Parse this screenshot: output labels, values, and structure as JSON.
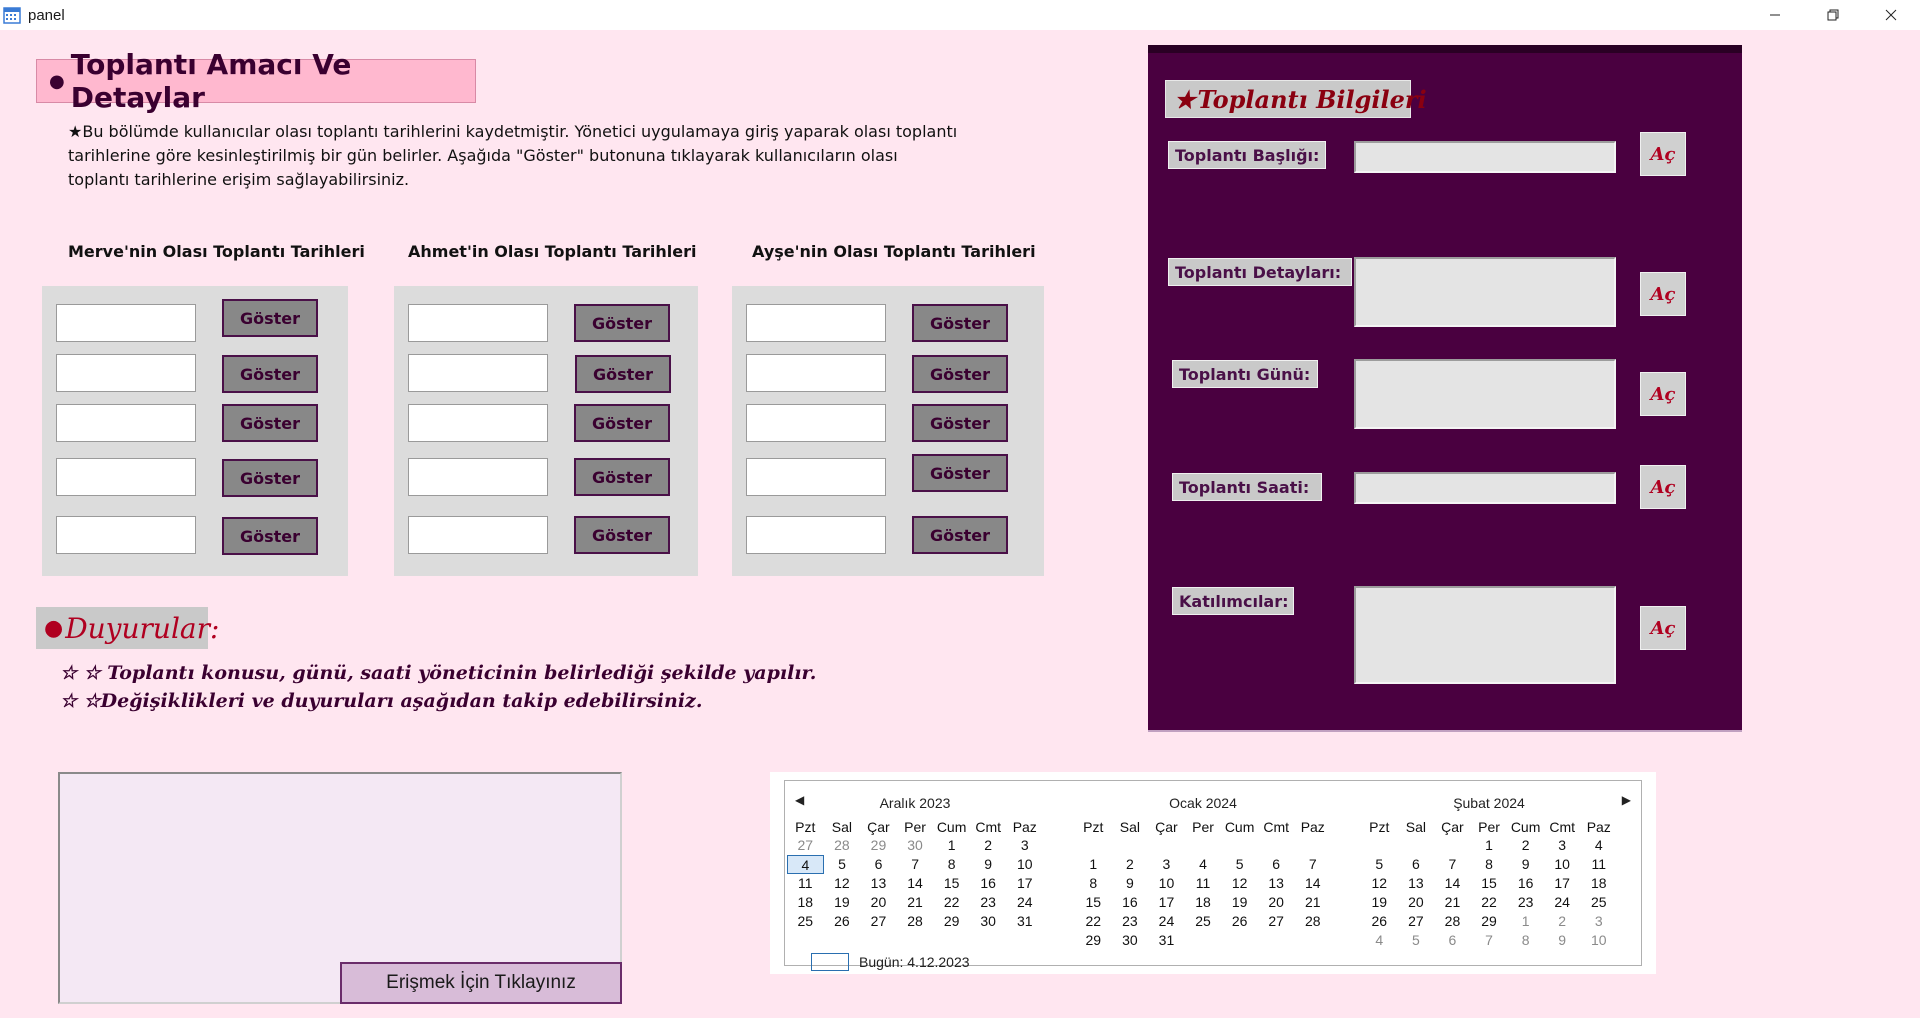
{
  "window": {
    "title": "panel",
    "icon": "calendar-app-icon"
  },
  "left": {
    "section_title": "Toplantı Amacı Ve Detaylar",
    "intro_lines": [
      "★Bu bölümde kullanıcılar olası toplantı tarihlerini kaydetmiştir. Yönetici uygulamaya giriş yaparak olası toplantı",
      "tarihlerine göre kesinleştirilmiş bir gün belirler. Aşağıda \"Göster\" butonuna tıklayarak kullanıcıların olası",
      "toplantı tarihlerine erişim sağlayabilirsiniz."
    ],
    "columns": [
      {
        "title": "Merve'nin Olası Toplantı Tarihleri",
        "button_label": "Göster",
        "values": [
          "",
          "",
          "",
          "",
          ""
        ]
      },
      {
        "title": "Ahmet'in Olası Toplantı Tarihleri",
        "button_label": "Göster",
        "values": [
          "",
          "",
          "",
          "",
          ""
        ]
      },
      {
        "title": "Ayşe'nin Olası Toplantı Tarihleri",
        "button_label": "Göster",
        "values": [
          "",
          "",
          "",
          "",
          ""
        ]
      }
    ]
  },
  "announcements": {
    "title": "Duyurular:",
    "lines": [
      "☆ ☆ Toplantı konusu, günü, saati yöneticinin belirlediği şekilde yapılır.",
      "☆ ☆Değişiklikleri ve duyuruları aşağıdan takip edebilirsiniz."
    ],
    "access_button": "Erişmek İçin Tıklayınız"
  },
  "info": {
    "title": "Toplantı Bilgileri",
    "open_label": "Aç",
    "fields": [
      {
        "label": "Toplantı Başlığı:",
        "value": ""
      },
      {
        "label": "Toplantı Detayları:",
        "value": ""
      },
      {
        "label": "Toplantı Günü:",
        "value": ""
      },
      {
        "label": "Toplantı Saati:",
        "value": ""
      },
      {
        "label": "Katılımcılar:",
        "value": ""
      }
    ]
  },
  "calendar": {
    "day_headers": [
      "Pzt",
      "Sal",
      "Çar",
      "Per",
      "Cum",
      "Cmt",
      "Paz"
    ],
    "today_label": "Bugün: 4.12.2023",
    "selected": "4",
    "months": [
      {
        "name": "Aralık 2023",
        "weeks": [
          [
            "27",
            "28",
            "29",
            "30",
            "1",
            "2",
            "3"
          ],
          [
            "4",
            "5",
            "6",
            "7",
            "8",
            "9",
            "10"
          ],
          [
            "11",
            "12",
            "13",
            "14",
            "15",
            "16",
            "17"
          ],
          [
            "18",
            "19",
            "20",
            "21",
            "22",
            "23",
            "24"
          ],
          [
            "25",
            "26",
            "27",
            "28",
            "29",
            "30",
            "31"
          ],
          [
            "",
            "",
            "",
            "",
            "",
            "",
            ""
          ]
        ]
      },
      {
        "name": "Ocak 2024",
        "weeks": [
          [
            "",
            "",
            "",
            "",
            "",
            "",
            ""
          ],
          [
            "1",
            "2",
            "3",
            "4",
            "5",
            "6",
            "7"
          ],
          [
            "8",
            "9",
            "10",
            "11",
            "12",
            "13",
            "14"
          ],
          [
            "15",
            "16",
            "17",
            "18",
            "19",
            "20",
            "21"
          ],
          [
            "22",
            "23",
            "24",
            "25",
            "26",
            "27",
            "28"
          ],
          [
            "29",
            "30",
            "31",
            "",
            "",
            "",
            ""
          ]
        ]
      },
      {
        "name": "Şubat 2024",
        "weeks": [
          [
            "",
            "",
            "",
            "1",
            "2",
            "3",
            "4"
          ],
          [
            "5",
            "6",
            "7",
            "8",
            "9",
            "10",
            "11"
          ],
          [
            "12",
            "13",
            "14",
            "15",
            "16",
            "17",
            "18"
          ],
          [
            "19",
            "20",
            "21",
            "22",
            "23",
            "24",
            "25"
          ],
          [
            "26",
            "27",
            "28",
            "29",
            "1",
            "2",
            "3"
          ],
          [
            "4",
            "5",
            "6",
            "7",
            "8",
            "9",
            "10"
          ]
        ]
      }
    ]
  }
}
